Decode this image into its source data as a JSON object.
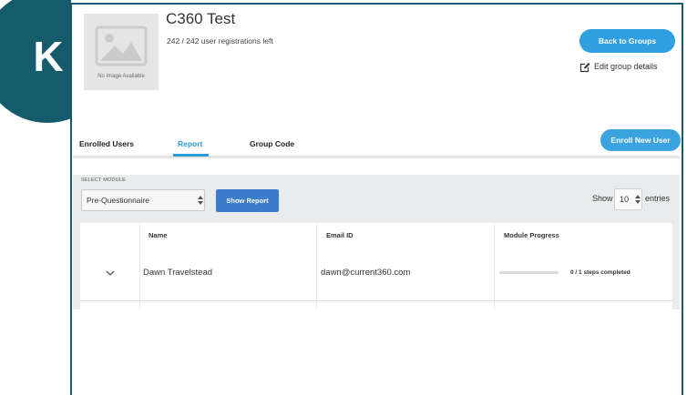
{
  "badge": {
    "letter": "K"
  },
  "group": {
    "title": "C360 Test",
    "registrations_left": "242 / 242 user registrations left",
    "image": {
      "placeholder_text": "No Image Available",
      "icon": "image-icon"
    }
  },
  "header_actions": {
    "back_to_groups": "Back to Groups",
    "edit_group_details": {
      "label": "Edit group details",
      "icon": "edit-icon"
    }
  },
  "tabs": [
    {
      "label": "Enrolled Users",
      "active": false
    },
    {
      "label": "Report",
      "active": true
    },
    {
      "label": "Group Code",
      "active": false
    }
  ],
  "enroll_new_user": "Enroll New User",
  "report": {
    "select_module": {
      "label": "SELECT MODULE",
      "value": "Pre-Questionnaire",
      "icon": "sort-arrows-icon"
    },
    "show_report": "Show Report",
    "page_length": {
      "prefix": "Show",
      "value": "10",
      "suffix": "entries",
      "icon": "sort-arrows-icon"
    },
    "table": {
      "columns": [
        {
          "label": "Name"
        },
        {
          "label": "Email ID"
        },
        {
          "label": "Module Progress"
        }
      ],
      "rows": [
        {
          "expand_icon": "chevron-down-icon",
          "name": "Dawn Travelstead",
          "email": "dawn@current360.com",
          "progress": {
            "completed": 0,
            "total": 1,
            "label": "0 / 1 steps completed"
          }
        }
      ]
    }
  },
  "colors": {
    "badge": "#165b6c",
    "accent": "#2f9fe0",
    "enroll_button": "#3ba3e0",
    "show_report_button": "#3b7dca",
    "active_tab": "#2b9bd8",
    "panel": "#e9ebec"
  }
}
